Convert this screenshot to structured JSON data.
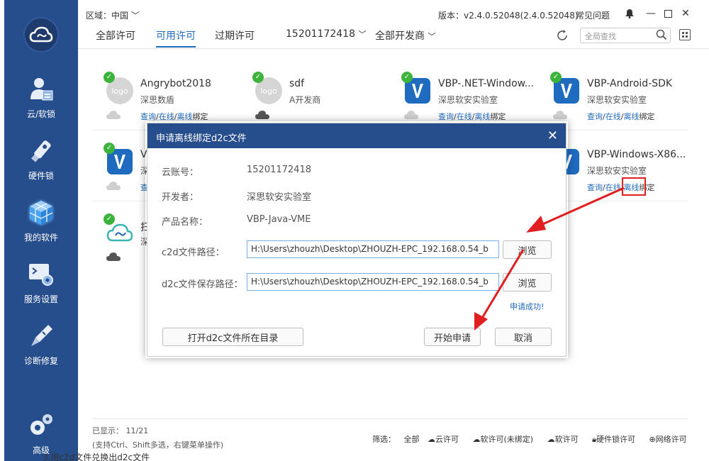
{
  "sidebar": {
    "items": [
      {
        "label": "云/软锁",
        "icon": "user-lock-icon"
      },
      {
        "label": "硬件锁",
        "icon": "usb-key-icon"
      },
      {
        "label": "我的软件",
        "icon": "cube-icon",
        "active": true
      },
      {
        "label": "服务设置",
        "icon": "terminal-gear-icon"
      },
      {
        "label": "诊断修复",
        "icon": "wrench-icon"
      },
      {
        "label": "高级",
        "icon": "gears-icon"
      }
    ]
  },
  "titlebar": {
    "region": "区域：中国",
    "version": "版本：v2.4.0.52048(2.4.0.52048)",
    "faq": "常见问题"
  },
  "tabs": [
    {
      "label": "全部许可"
    },
    {
      "label": "可用许可",
      "active": true
    },
    {
      "label": "过期许可"
    },
    {
      "label": "15201172418"
    },
    {
      "label": "全部开发商"
    }
  ],
  "search": {
    "placeholder": "全局查找"
  },
  "cards": [
    {
      "name": "Angrybot2018",
      "developer": "深思数盾",
      "logo": "grey"
    },
    {
      "name": "sdf",
      "developer": "A开发商",
      "logo": "grey"
    },
    {
      "name": "VBP-.NET-Window...",
      "developer": "深思软安实验室",
      "logo": "v"
    },
    {
      "name": "VBP-Android-SDK",
      "developer": "深思软安实验室",
      "logo": "v"
    },
    {
      "name": "V",
      "developer": "深",
      "logo": "v"
    },
    {
      "name": "VBP-Windows-X86...",
      "developer": "深思软安实验室",
      "logo": "v"
    },
    {
      "name": "扫",
      "developer": "深",
      "logo": "cloud"
    }
  ],
  "links": {
    "query": "查询",
    "online": "在线",
    "offline": "离线",
    "bind": "绑定",
    "sep": "/"
  },
  "bottom": {
    "shown": "已显示：  11/21",
    "hint": "(支持Ctrl、Shift多选，右键菜单操作)",
    "filter_label": "筛选：",
    "filters": [
      "全部",
      "云许可",
      "软许可(未绑定)",
      "软许可",
      "硬件锁许可",
      "网络许可"
    ]
  },
  "dialog": {
    "title": "申请离线绑定d2c文件",
    "account_label": "云账号：",
    "account_value": "15201172418",
    "developer_label": "开发者：",
    "developer_value": "深思软安实验室",
    "product_label": "产品名称：",
    "product_value": "VBP-Java-VME",
    "c2d_label": "c2d文件路径：",
    "c2d_value": "H:\\Users\\zhouzh\\Desktop\\ZHOUZH-EPC_192.168.0.54_b",
    "d2c_label": "d2c文件保存路径：",
    "d2c_value": "H:\\Users\\zhouzh\\Desktop\\ZHOUZH-EPC_192.168.0.54_b",
    "browse": "浏览",
    "success": "申请成功!",
    "open_dir": "打开d2c文件所在目录",
    "start": "开始申请",
    "cancel": "取消"
  },
  "caption": "3.用c2d文件兑换出d2c文件",
  "colors": {
    "sidebar": "#264d8c",
    "accent": "#1f6bbf",
    "check": "#3cb43c",
    "annotation": "#e02020"
  }
}
